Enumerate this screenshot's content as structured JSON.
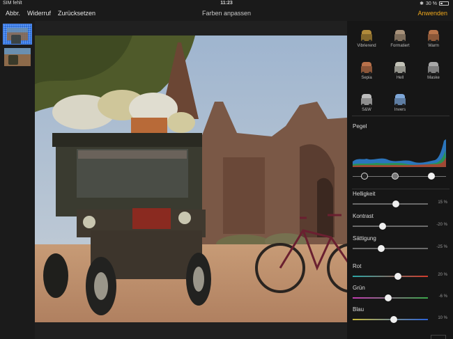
{
  "status": {
    "carrier": "SIM fehlt",
    "time": "11:23",
    "battery": "30 %"
  },
  "toolbar": {
    "cancel_label": "Abbr.",
    "undo_label": "Widerruf",
    "reset_label": "Zurücksetzen",
    "title": "Farben anpassen",
    "apply_label": "Anwenden",
    "accent_color": "#f0a81c"
  },
  "presets": [
    {
      "label": "Vibrierend",
      "tint": "#b08a3a"
    },
    {
      "label": "Formatiert",
      "tint": "#a8927a"
    },
    {
      "label": "Warm",
      "tint": "#b9744a"
    },
    {
      "label": "Sepia",
      "tint": "#b8714b"
    },
    {
      "label": "Hell",
      "tint": "#c3c3b8"
    },
    {
      "label": "Maske",
      "tint": "#a8a8a8"
    },
    {
      "label": "S&W",
      "tint": "#bdbdbd"
    },
    {
      "label": "Invers",
      "tint": "#7ea7d8"
    }
  ],
  "levels": {
    "label": "Pegel"
  },
  "sliders": [
    {
      "name": "Helligkeit",
      "value": "15 %",
      "fraction": 0.57,
      "tint": ""
    },
    {
      "name": "Kontrast",
      "value": "-20 %",
      "fraction": 0.4,
      "tint": ""
    },
    {
      "name": "Sättigung",
      "value": "-25 %",
      "fraction": 0.38,
      "tint": ""
    },
    {
      "name": "Rot",
      "value": "20 %",
      "fraction": 0.6,
      "tint": "red"
    },
    {
      "name": "Grün",
      "value": "-6 %",
      "fraction": 0.47,
      "tint": "green"
    },
    {
      "name": "Blau",
      "value": "10 %",
      "fraction": 0.55,
      "tint": "blue"
    }
  ]
}
